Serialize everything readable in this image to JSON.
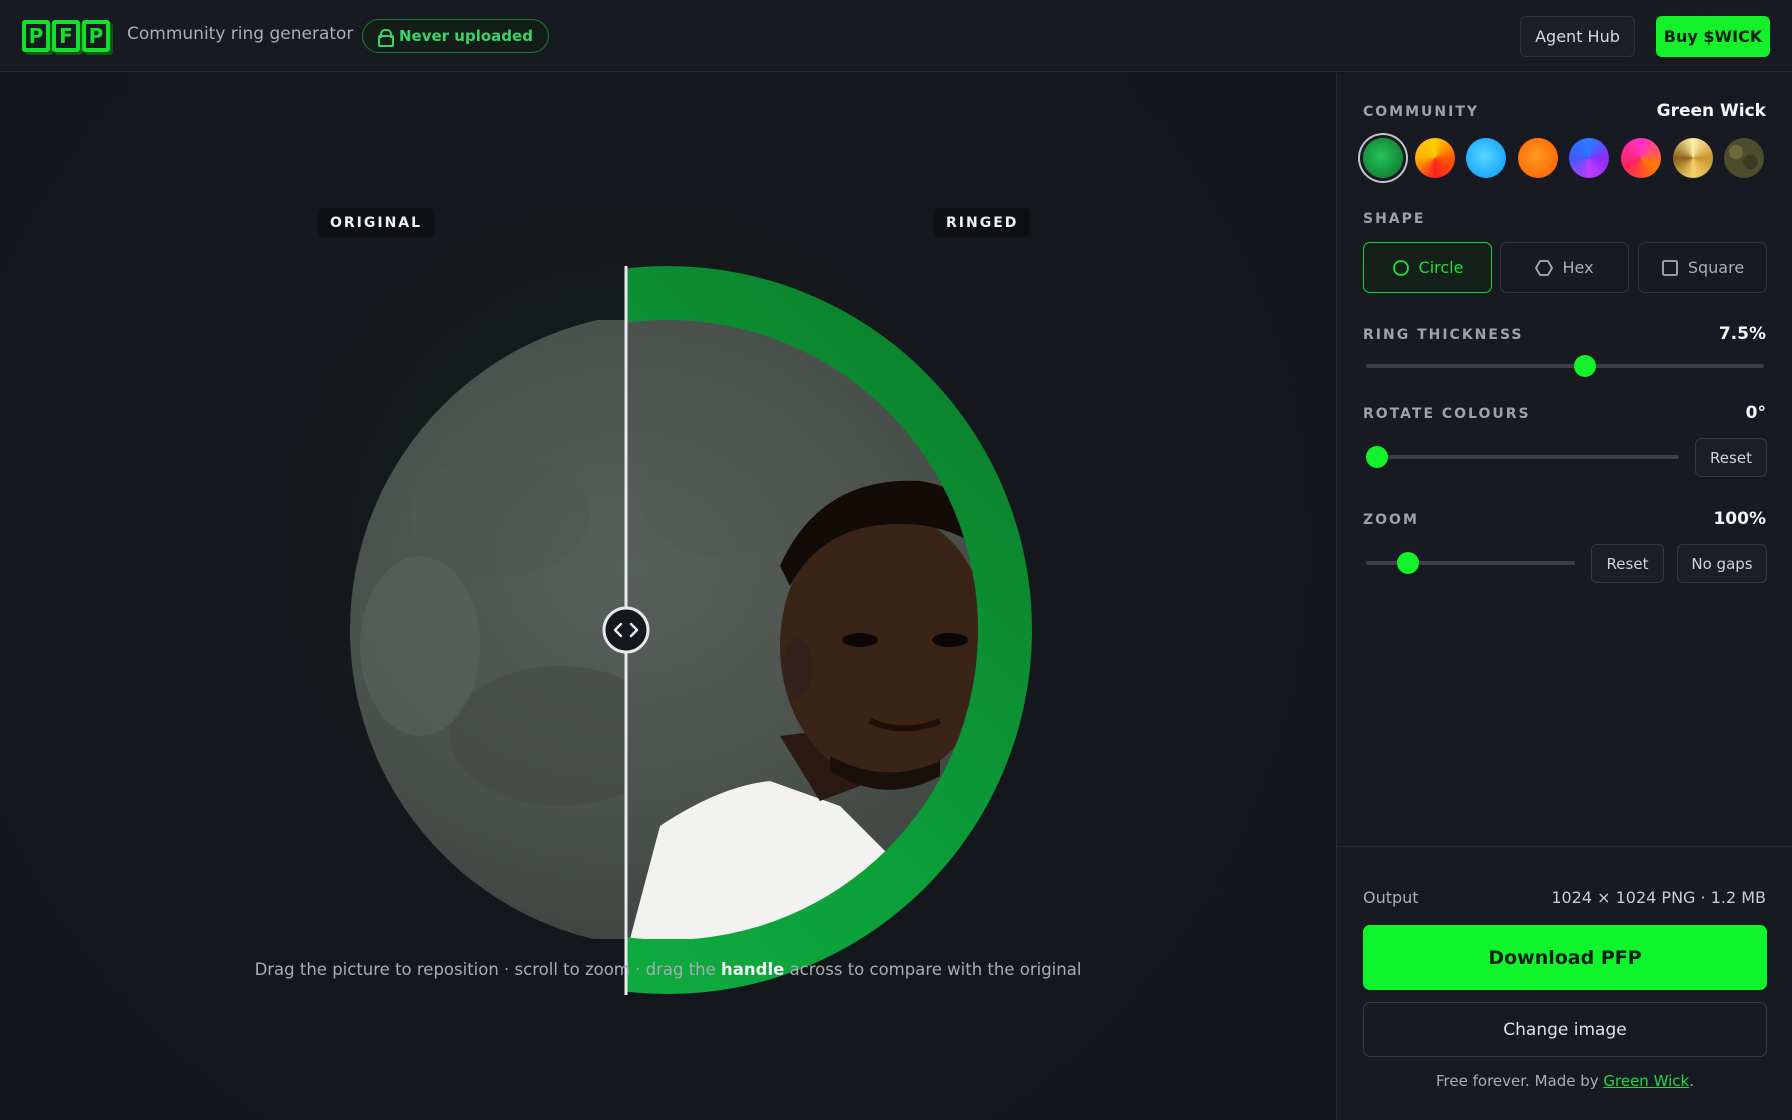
{
  "header": {
    "logo_letters": [
      "P",
      "F",
      "P"
    ],
    "subtitle": "Community ring generator",
    "badge": "Never uploaded",
    "agent_hub": "Agent Hub",
    "buy": "Buy $WICK"
  },
  "canvas": {
    "label_original": "ORIGINAL",
    "label_ringed": "RINGED",
    "hint_before": "Drag the picture to reposition · scroll to zoom · drag the ",
    "hint_strong": "handle",
    "hint_after": " across to compare with the original"
  },
  "panel": {
    "community_label": "COMMUNITY",
    "community_value": "Green Wick",
    "swatches": [
      {
        "name": "green",
        "fill": "radial-gradient(circle at 45% 45%, #25c35a, #0a6d26)",
        "selected": true
      },
      {
        "name": "fire",
        "fill": "conic-gradient(#ffd000, #ff5a00, #ff1f1f, #ffb000, #ffd000)"
      },
      {
        "name": "sky",
        "fill": "radial-gradient(circle at 45% 45%, #58d7ff, #0096ff)"
      },
      {
        "name": "orange",
        "fill": "radial-gradient(circle at 45% 45%, #ff9a20, #ff5a00)"
      },
      {
        "name": "violet",
        "fill": "conic-gradient(#2a7bff, #8b2cff, #c03bff, #3f5bff, #2a7bff)"
      },
      {
        "name": "magenta",
        "fill": "conic-gradient(#ff2bd2, #ff7a00, #ff2060, #ff36c8)"
      },
      {
        "name": "gold",
        "fill": "conic-gradient(#fff0a8, #c8962c, #f5d36a, #8a6218, #fff0a8)"
      },
      {
        "name": "camo",
        "fill": "radial-gradient(circle at 30% 35%, #6a6a3a 0 18%, transparent 19%), radial-gradient(circle at 66% 60%, #3b3b22 0 20%, transparent 21%), #4c4e2e"
      }
    ],
    "shape_label": "SHAPE",
    "shapes": [
      {
        "label": "Circle",
        "active": true
      },
      {
        "label": "Hex",
        "active": false
      },
      {
        "label": "Square",
        "active": false
      }
    ],
    "ring_label": "RING THICKNESS",
    "ring_value": "7.5%",
    "ring_position": 0.55,
    "rotate_label": "ROTATE COLOURS",
    "rotate_value": "0°",
    "rotate_position": 0.0,
    "rotate_reset": "Reset",
    "zoom_label": "ZOOM",
    "zoom_value": "100%",
    "zoom_position": 0.2,
    "zoom_reset": "Reset",
    "no_gaps": "No gaps",
    "output_label": "Output",
    "output_value": "1024 × 1024 PNG · 1.2 MB",
    "download": "Download PFP",
    "change": "Change image",
    "footer_text": "Free forever. Made by ",
    "footer_link": "Green Wick",
    "footer_end": "."
  },
  "colors": {
    "accent": "#13f12b",
    "ring": "#0fa83d",
    "background": "#15171d",
    "panel": "#181a21"
  }
}
